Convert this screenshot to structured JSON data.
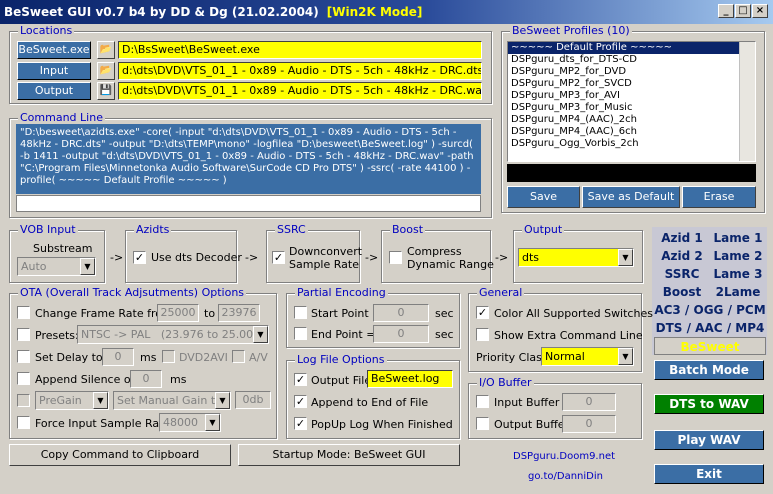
{
  "window": {
    "title": "BeSweet GUI v0.7 b4 by DD & Dg (21.02.2004)",
    "mode": "[Win2K Mode]",
    "minimize": "_",
    "maximize": "□",
    "close": "×"
  },
  "locations": {
    "label": "Locations",
    "besweet_label": "BeSweet.exe",
    "besweet_path": "D:\\BsSweet\\BeSweet.exe",
    "input_label": "Input",
    "input_path": "d:\\dts\\DVD\\VTS_01_1 - 0x89 - Audio - DTS - 5ch - 48kHz - DRC.dts",
    "output_label": "Output",
    "output_path": "d:\\dts\\DVD\\VTS_01_1 - 0x89 - Audio - DTS - 5ch - 48kHz - DRC.wav"
  },
  "profiles": {
    "label": "BeSweet Profiles (10)",
    "items": [
      "~~~~~ Default Profile ~~~~~",
      "DSPguru_dts_for_DTS-CD",
      "DSPguru_MP2_for_DVD",
      "DSPguru_MP2_for_SVCD",
      "DSPguru_MP3_for_AVI",
      "DSPguru_MP3_for_Music",
      "DSPguru_MP4_(AAC)_2ch",
      "DSPguru_MP4_(AAC)_6ch",
      "DSPguru_Ogg_Vorbis_2ch"
    ],
    "save": "Save",
    "save_default": "Save as Default",
    "erase": "Erase"
  },
  "command_line": {
    "label": "Command Line",
    "text": "\"D:\\besweet\\azidts.exe\" -core( -input \"d:\\dts\\DVD\\VTS_01_1 - 0x89 - Audio - DTS - 5ch - 48kHz - DRC.dts\" -output \"D:\\dts\\TEMP\\mono\" -logfilea \"D:\\besweet\\BeSweet.log\" ) -surcd( -b 1411 -output \"d:\\dts\\DVD\\VTS_01_1 - 0x89 - Audio - DTS - 5ch - 48kHz - DRC.wav\" -path \"C:\\Program Files\\Minnetonka Audio Software\\SurCode CD Pro DTS\" ) -ssrc( -rate 44100 ) -profile( ~~~~~ Default Profile ~~~~~ )"
  },
  "vob": {
    "label": "VOB Input",
    "substream_label": "Substream",
    "substream_value": "Auto"
  },
  "azidts": {
    "label": "Azidts",
    "use_dts": "Use dts Decoder"
  },
  "ssrc": {
    "label": "SSRC",
    "downconvert": "Downconvert",
    "sample_rate": "Sample Rate"
  },
  "boost": {
    "label": "Boost",
    "compress": "Compress",
    "dynamic": "Dynamic Range"
  },
  "output_group": {
    "label": "Output",
    "value": "dts"
  },
  "arrows": {
    "a1": "->",
    "a2": "->",
    "a3": "->",
    "a4": "->"
  },
  "codec_panel": {
    "rows": [
      [
        "Azid 1",
        "Lame 1"
      ],
      [
        "Azid 2",
        "Lame 2"
      ],
      [
        "SSRC",
        "Lame 3"
      ],
      [
        "Boost",
        "2Lame"
      ]
    ],
    "ac3": "AC3 / OGG / PCM",
    "dts": "DTS / AAC / MP4",
    "besweet": "BeSweet"
  },
  "ota": {
    "label": "OTA (Overall Track Adjsutments) Options",
    "change_frame_rate": "Change Frame Rate from",
    "fr_from": "25000",
    "fr_to_label": "to",
    "fr_to": "23976",
    "presets": "Presets:",
    "preset_value": "NTSC -> PAL",
    "preset_detail": "(23.976 to 25.000)",
    "set_delay": "Set Delay to",
    "delay": "0",
    "ms": "ms",
    "dvd2avi": "DVD2AVI",
    "av": "A/V",
    "append_silence": "Append Silence of",
    "silence": "0",
    "ms2": "ms",
    "pregain": "PreGain",
    "manual_gain": "Set Manual Gain to",
    "gain": "0db",
    "force_rate": "Force Input Sample Rate",
    "force_rate_value": "48000"
  },
  "partial": {
    "label": "Partial Encoding",
    "start": "Start Point =",
    "start_val": "0",
    "end": "End Point =",
    "end_val": "0",
    "sec1": "sec",
    "sec2": "sec"
  },
  "logfile": {
    "label": "Log File Options",
    "output_file": "Output File",
    "file": "BeSweet.log",
    "append": "Append to End of File",
    "popup": "PopUp Log When Finished"
  },
  "general": {
    "label": "General",
    "color_switches": "Color All Supported Switches",
    "extra_cmd": "Show Extra Command Line",
    "priority": "Priority Class",
    "priority_value": "Normal"
  },
  "io": {
    "label": "I/O Buffer",
    "input": "Input Buffer",
    "input_val": "0",
    "output": "Output Buffer",
    "output_val": "0"
  },
  "buttons": {
    "copy": "Copy Command to Clipboard",
    "startup": "Startup Mode: BeSweet GUI",
    "batch": "Batch Mode",
    "dts_wav": "DTS to WAV",
    "play": "Play WAV",
    "exit": "Exit"
  },
  "links": {
    "site": "DSPguru.Doom9.net",
    "goto": "go.to/DanniDin"
  },
  "colors": {
    "accent_blue": "#3b6ea5",
    "yellow_field": "#ffff00",
    "green_btn": "#008000",
    "title_bar": "#0a246a"
  }
}
